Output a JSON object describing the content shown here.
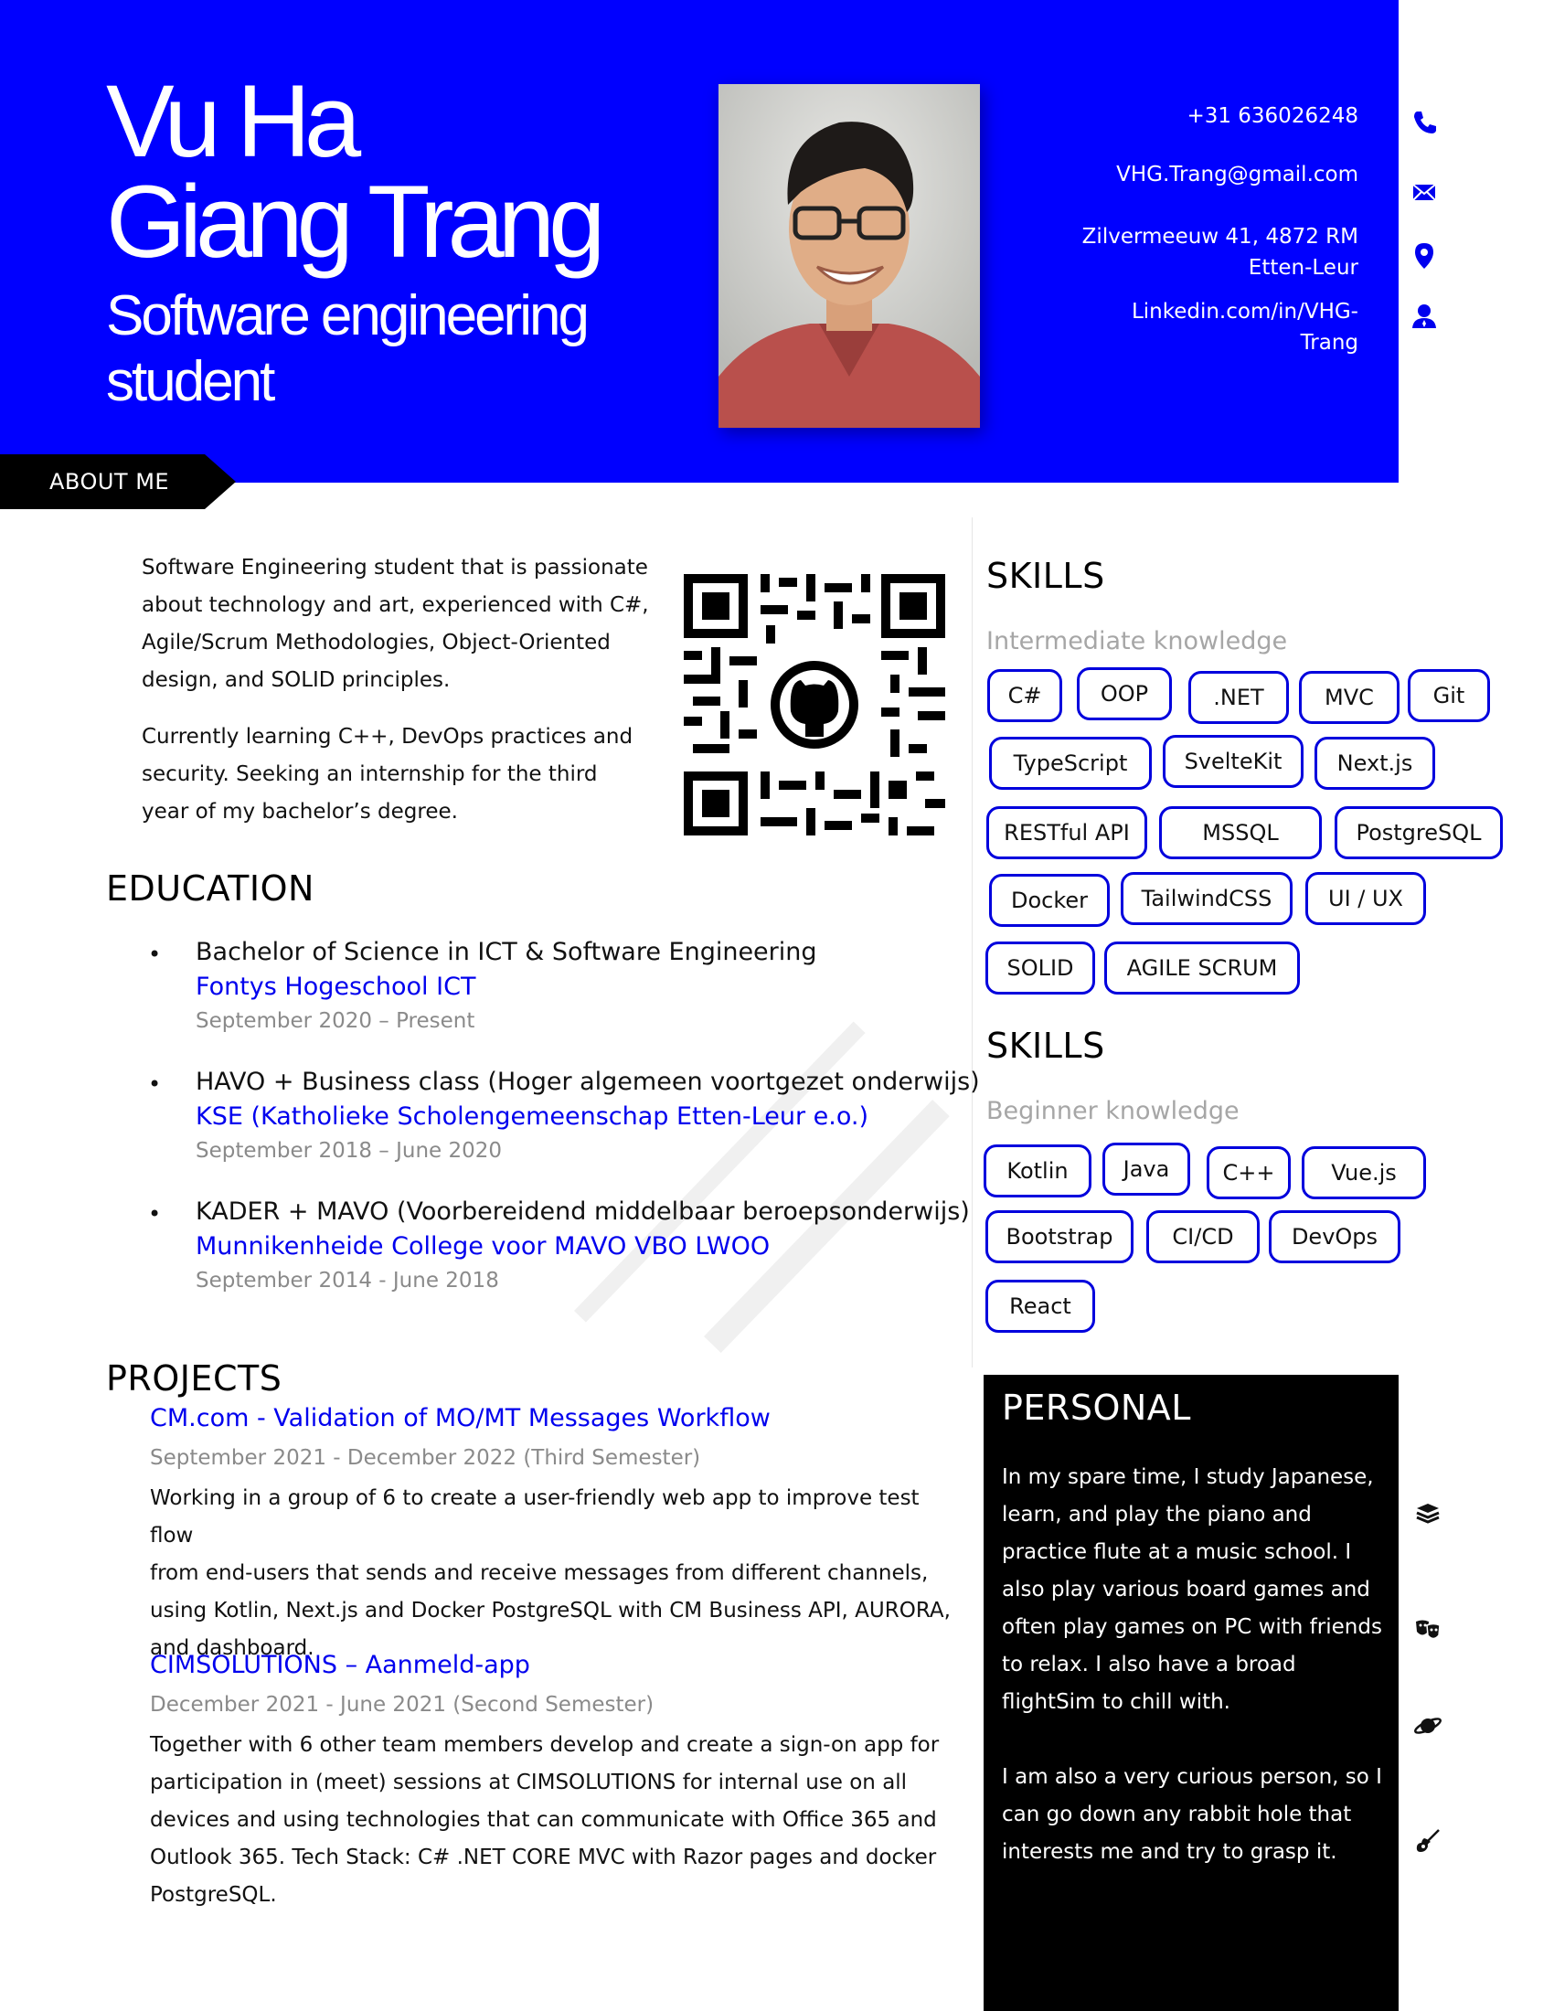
{
  "header": {
    "name_line1": "Vu Ha",
    "name_line2": "Giang Trang",
    "role_line1": "Software engineering",
    "role_line2": "student",
    "colors": {
      "accent": "#0000ff",
      "text": "#ffffff"
    }
  },
  "contact": {
    "phone": "+31 636026248",
    "email": "VHG.Trang@gmail.com",
    "address_line1": "Zilvermeeuw 41, 4872 RM",
    "address_line2": "Etten-Leur",
    "linkedin_line1": "Linkedin.com/in/VHG-",
    "linkedin_line2": "Trang",
    "icons": [
      "phone-icon",
      "mail-icon",
      "location-icon",
      "profile-icon"
    ]
  },
  "about": {
    "tab_label": "ABOUT ME",
    "para1": [
      "Software Engineering student that is passionate",
      "about technology and art, experienced with C#,",
      "Agile/Scrum Methodologies, Object-Oriented",
      "design, and SOLID principles."
    ],
    "para2": [
      "Currently learning C++, DevOps practices and",
      "security. Seeking an internship for the third",
      "year of my bachelor’s degree."
    ]
  },
  "education": {
    "title": "EDUCATION",
    "items": [
      {
        "degree": "Bachelor of Science in ICT & Software Engineering",
        "school": "Fontys Hogeschool ICT",
        "dates": "September 2020 – Present"
      },
      {
        "degree": "HAVO + Business class (Hoger algemeen voortgezet onderwijs)",
        "school": "KSE (Katholieke Scholengemeenschap Etten-Leur e.o.)",
        "dates": "September 2018 – June 2020"
      },
      {
        "degree": "KADER + MAVO (Voorbereidend middelbaar beroepsonderwijs)",
        "school": "Munnikenheide College voor MAVO VBO LWOO",
        "dates": "September 2014 - June 2018"
      }
    ]
  },
  "projects": {
    "title": "PROJECTS",
    "items": [
      {
        "name": "CM.com - Validation of MO/MT Messages Workflow",
        "dates": "September 2021 - December 2022 (Third Semester)",
        "lines": [
          "Working in a group of 6 to create a user-friendly web app to improve test flow",
          "from end-users that sends and receive messages from different channels,",
          "using Kotlin, Next.js and Docker PostgreSQL with CM Business API, AURORA,",
          "and dashboard."
        ]
      },
      {
        "name": "CIMSOLUTIONS – Aanmeld-app",
        "dates": "December 2021 - June 2021 (Second Semester)",
        "lines": [
          "Together with 6 other team members develop and create a sign-on app for",
          "participation in (meet) sessions at CIMSOLUTIONS for internal use on all",
          "devices and using technologies that can communicate with Office 365 and",
          "Outlook 365. Tech Stack: C# .NET CORE MVC with Razor pages and docker",
          "PostgreSQL."
        ]
      }
    ]
  },
  "skills_intermediate": {
    "title": "SKILLS",
    "subtitle": "Intermediate knowledge",
    "items": [
      "C#",
      "OOP",
      ".NET",
      "MVC",
      "Git",
      "TypeScript",
      "SvelteKit",
      "Next.js",
      "RESTful API",
      "MSSQL",
      "PostgreSQL",
      "Docker",
      "TailwindCSS",
      "UI / UX",
      "SOLID",
      "AGILE SCRUM"
    ]
  },
  "skills_beginner": {
    "title": "SKILLS",
    "subtitle": "Beginner knowledge",
    "items": [
      "Kotlin",
      "Java",
      "C++",
      "Vue.js",
      "Bootstrap",
      "CI/CD",
      "DevOps",
      "React"
    ]
  },
  "personal": {
    "title": "PERSONAL",
    "lines1": [
      "In my spare time, I study Japanese,",
      "learn, and play the piano and",
      "practice flute at a music school. I",
      "also play various board games and",
      "often play games on PC with friends",
      "to relax. I also have a broad",
      "flightSim to chill with."
    ],
    "lines2": [
      "I am also a very curious person, so I",
      "can go down any rabbit hole that",
      "interests me and try to grasp it."
    ],
    "icons": [
      "books-icon",
      "theater-masks-icon",
      "planet-icon",
      "guitar-icon"
    ]
  }
}
